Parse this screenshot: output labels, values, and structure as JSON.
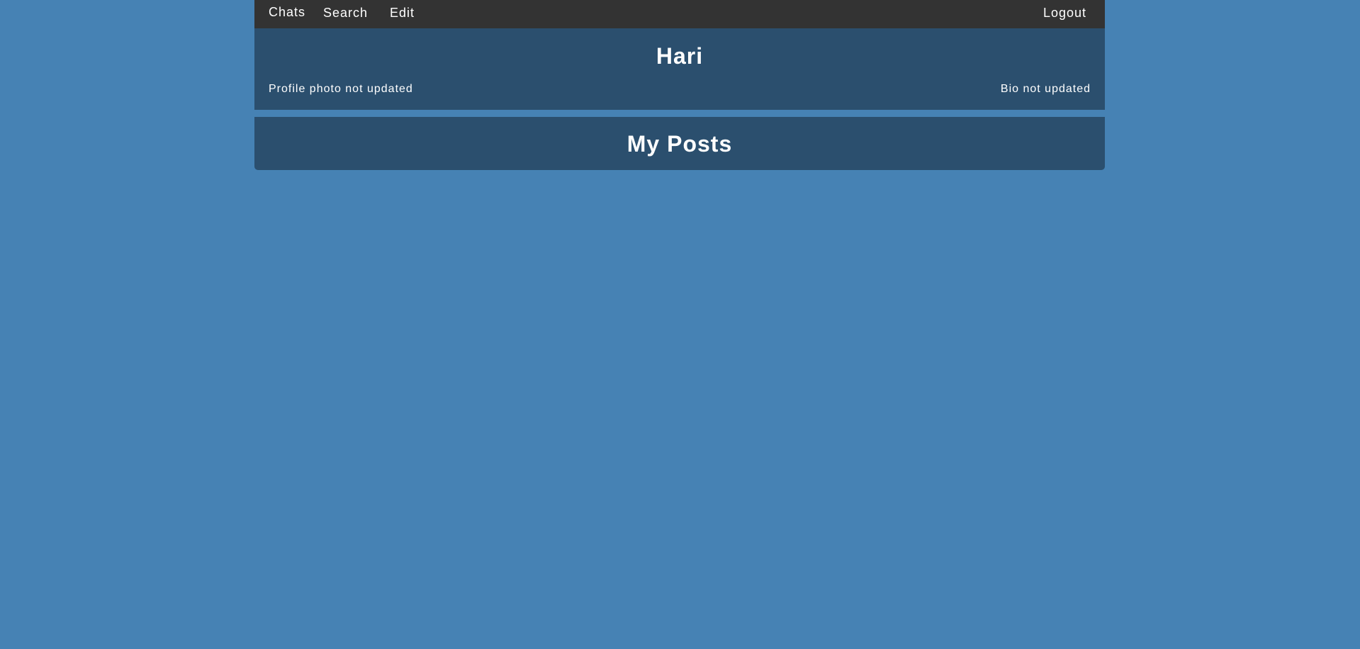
{
  "nav": {
    "chats": "Chats",
    "search": "Search",
    "edit": "Edit",
    "logout": "Logout"
  },
  "profile": {
    "name": "Hari",
    "photo_status": "Profile photo not updated",
    "bio_status": "Bio not updated"
  },
  "posts": {
    "title": "My Posts",
    "items": []
  },
  "colors": {
    "background": "#4682b4",
    "navbar": "#333333",
    "panel": "#2b4f6e",
    "text": "#ffffff"
  }
}
